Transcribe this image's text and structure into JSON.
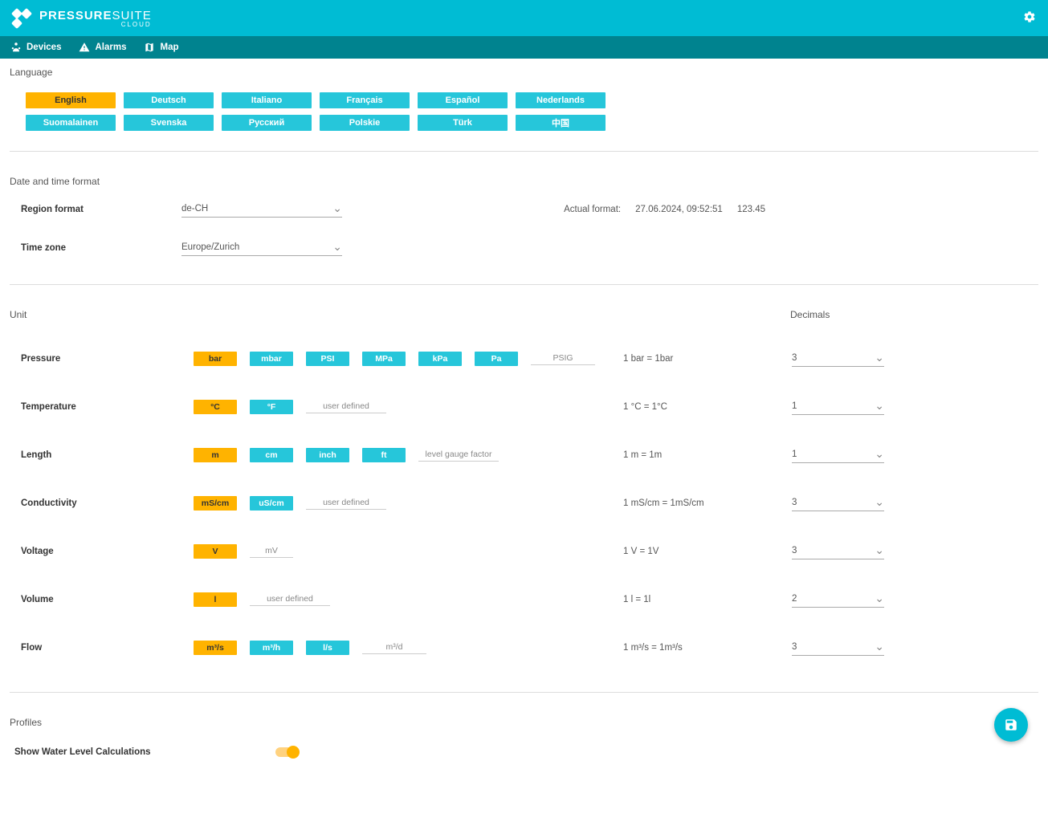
{
  "header": {
    "brand_main": "PRESSURE",
    "brand_sub": "SUITE",
    "brand_tag": "CLOUD"
  },
  "nav": {
    "devices": "Devices",
    "alarms": "Alarms",
    "map": "Map"
  },
  "language": {
    "title": "Language",
    "options_row1": [
      "English",
      "Deutsch",
      "Italiano",
      "Français",
      "Español",
      "Nederlands"
    ],
    "options_row2": [
      "Suomalainen",
      "Svenska",
      "Русский",
      "Polskie",
      "Türk",
      "中国"
    ],
    "selected": "English"
  },
  "datetime": {
    "title": "Date and time format",
    "region_label": "Region format",
    "region_value": "de-CH",
    "tz_label": "Time zone",
    "tz_value": "Europe/Zurich",
    "actual_label": "Actual format:",
    "actual_date": "27.06.2024, 09:52:51",
    "actual_num": "123.45"
  },
  "unit": {
    "title": "Unit",
    "decimals_label": "Decimals",
    "rows": [
      {
        "label": "Pressure",
        "buttons": [
          "bar",
          "mbar",
          "PSI",
          "MPa",
          "kPa",
          "Pa"
        ],
        "ghost": "PSIG",
        "selected": "bar",
        "conv": "1 bar = 1bar",
        "dec": "3"
      },
      {
        "label": "Temperature",
        "buttons": [
          "°C",
          "°F"
        ],
        "ghost": "user defined",
        "selected": "°C",
        "conv": "1 °C = 1°C",
        "dec": "1"
      },
      {
        "label": "Length",
        "buttons": [
          "m",
          "cm",
          "inch",
          "ft"
        ],
        "ghost": "level gauge factor",
        "selected": "m",
        "conv": "1 m = 1m",
        "dec": "1"
      },
      {
        "label": "Conductivity",
        "buttons": [
          "mS/cm",
          "uS/cm"
        ],
        "ghost": "user defined",
        "selected": "mS/cm",
        "conv": "1 mS/cm = 1mS/cm",
        "dec": "3"
      },
      {
        "label": "Voltage",
        "buttons": [
          "V",
          "mV"
        ],
        "ghost": "",
        "selected": "V",
        "conv": "1 V = 1V",
        "dec": "3",
        "mvGhost": true
      },
      {
        "label": "Volume",
        "buttons": [
          "l"
        ],
        "ghost": "user defined",
        "selected": "l",
        "conv": "1 l = 1l",
        "dec": "2"
      },
      {
        "label": "Flow",
        "buttons": [
          "m³/s",
          "m³/h",
          "l/s"
        ],
        "ghost": "m³/d",
        "selected": "m³/s",
        "conv": "1 m³/s = 1m³/s",
        "dec": "3"
      }
    ]
  },
  "profiles": {
    "title": "Profiles",
    "show_water": "Show Water Level Calculations"
  }
}
